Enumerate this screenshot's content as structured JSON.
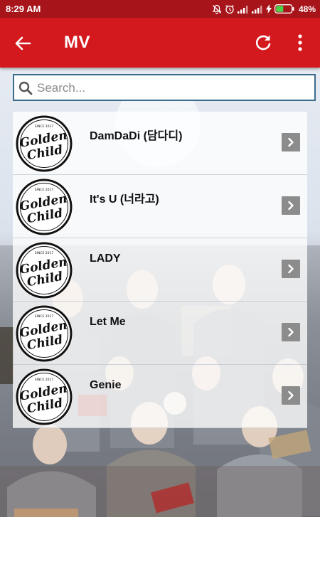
{
  "status_bar": {
    "time": "8:29 AM",
    "battery_percent": "48%",
    "battery_level": 0.48,
    "icons": [
      "mute-icon",
      "alarm-icon",
      "signal-icon",
      "signal-icon",
      "charging-icon",
      "battery-icon"
    ]
  },
  "app_bar": {
    "title": "MV",
    "back_icon": "arrow-left-icon",
    "refresh_icon": "refresh-icon",
    "menu_icon": "more-vert-icon"
  },
  "search": {
    "placeholder": "Search...",
    "value": ""
  },
  "mv_list": [
    {
      "title": "DamDaDi (담다디)",
      "thumbnail": "golden-child-logo"
    },
    {
      "title": "It's U (너라고)",
      "thumbnail": "golden-child-logo"
    },
    {
      "title": "LADY",
      "thumbnail": "golden-child-logo"
    },
    {
      "title": "Let Me",
      "thumbnail": "golden-child-logo"
    },
    {
      "title": "Genie",
      "thumbnail": "golden-child-logo"
    }
  ],
  "logo": {
    "top_text": "SINCE 2017",
    "line1": "Golden",
    "line2": "Child"
  },
  "colors": {
    "status_bar": "#a7151b",
    "app_bar": "#d4191e",
    "search_border": "#3b6c8c",
    "arrow_button": "#8c8c8c"
  }
}
